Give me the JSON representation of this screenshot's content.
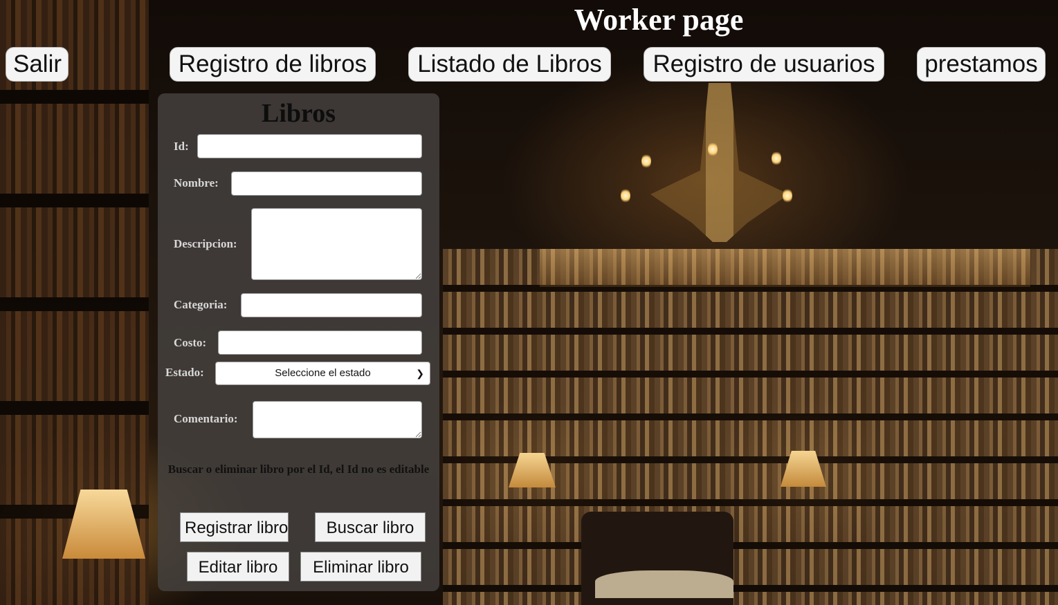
{
  "page": {
    "title": "Worker page"
  },
  "nav": {
    "salir": "Salir",
    "registro_libros": "Registro de libros",
    "listado_libros": "Listado de Libros",
    "registro_usuarios": "Registro de usuarios",
    "prestamos": "prestamos"
  },
  "form": {
    "title": "Libros",
    "id_label": "Id:",
    "nombre_label": "Nombre:",
    "descripcion_label": "Descripcion:",
    "categoria_label": "Categoria:",
    "costo_label": "Costo:",
    "estado_label": "Estado:",
    "estado_selected": "Seleccione el estado",
    "comentario_label": "Comentario:",
    "note": "Buscar o eliminar libro por el Id, el Id no es editable",
    "values": {
      "id": "",
      "nombre": "",
      "descripcion": "",
      "categoria": "",
      "costo": "",
      "comentario": ""
    }
  },
  "actions": {
    "registrar": "Registrar libro",
    "buscar": "Buscar libro",
    "editar": "Editar libro",
    "eliminar": "Eliminar libro"
  },
  "icons": {
    "select_arrow": "chevron-down-icon"
  },
  "colors": {
    "panel": "#46423f",
    "title": "#ffffff",
    "button_bg": "#f4f4f4"
  }
}
